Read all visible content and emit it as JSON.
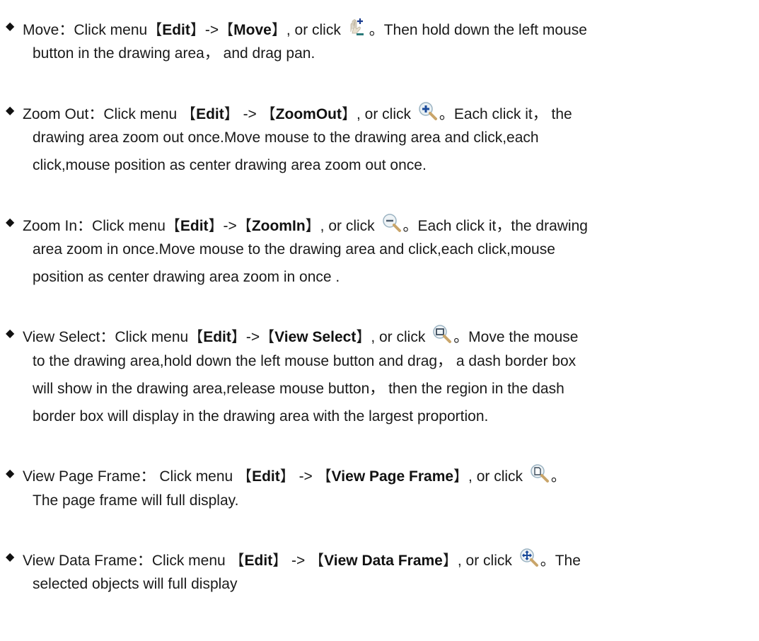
{
  "items": [
    {
      "name": "Move",
      "lines": [
        [
          "Move：Click menu",
          "【",
          "Edit",
          "】->",
          "【",
          "Move",
          "】, or click ",
          "ICON",
          "。Then hold down the left mouse"
        ],
        [
          "button in the drawing area， and drag pan."
        ]
      ],
      "icon": "move-hand-icon"
    }
  ],
  "move": {
    "l1_a": "Move：Click menu",
    "l1_b1": "【",
    "l1_edit": "Edit",
    "l1_arrow": "】->【",
    "l1_move": "Move",
    "l1_c": "】, or click",
    "l1_d": "。Then hold down the left mouse",
    "l2": "button in the drawing area， and drag pan.",
    "icon": "move-hand-icon"
  },
  "zoomout": {
    "l1_a": "Zoom Out：Click menu 【",
    "l1_edit": "Edit",
    "l1_arrow": "】 -> 【",
    "l1_cmd": "ZoomOut",
    "l1_c": "】, or click",
    "l1_d": "。Each click it， the",
    "l2": "drawing area zoom out once.Move mouse to the drawing area and click,each",
    "l3": "click,mouse position as center drawing area zoom out once.",
    "icon": "zoom-plus-icon"
  },
  "zoomin": {
    "l1_a": "Zoom In：Click menu【",
    "l1_edit": "Edit",
    "l1_arrow": "】->【",
    "l1_cmd": "ZoomIn",
    "l1_c": "】, or click",
    "l1_d": "。Each click it，the drawing",
    "l2": "area zoom in once.Move mouse to the drawing area and click,each click,mouse",
    "l3": "position as center drawing area zoom in once .",
    "icon": "zoom-minus-icon"
  },
  "viewselect": {
    "l1_a": "View Select：Click menu【",
    "l1_edit": "Edit",
    "l1_arrow": "】->【",
    "l1_cmd": "View Select",
    "l1_c": "】, or click",
    "l1_d": "。Move the mouse",
    "l2": "to the drawing area,hold down the left mouse button and drag， a dash border box",
    "l3": "will show in the drawing area,release mouse button， then the region in the dash",
    "l4": "border box will display in the drawing area with the largest proportion.",
    "icon": "zoom-window-icon"
  },
  "pageframe": {
    "l1_a": "View Page Frame： Click menu 【",
    "l1_edit": "Edit",
    "l1_arrow": "】 -> 【",
    "l1_cmd": "View Page Frame",
    "l1_c": "】, or click",
    "l1_d": "。",
    "l2": "The page frame will full display.",
    "icon": "zoom-page-icon"
  },
  "dataframe": {
    "l1_a": "View Data Frame：Click menu 【",
    "l1_edit": "Edit",
    "l1_arrow": "】 -> 【",
    "l1_cmd": "View Data Frame",
    "l1_c": "】, or click",
    "l1_d": "。The",
    "l2": "selected objects will full display",
    "icon": "zoom-extents-icon"
  },
  "bullet_glyph": "◆"
}
